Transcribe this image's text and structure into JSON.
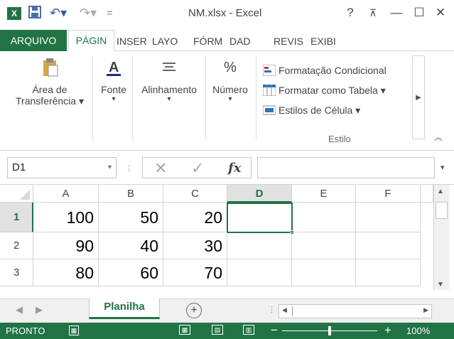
{
  "window": {
    "title": "NM.xlsx - Excel",
    "logo": "X",
    "help": "?",
    "controls": [
      "⊼",
      "—",
      "☐",
      "✕"
    ]
  },
  "quick_access": {
    "save_icon": "save-icon",
    "undo": "↶▾",
    "redo": "↷▾",
    "customize": "="
  },
  "tabs": {
    "file": "ARQUIVO",
    "active": "PÁGIN",
    "others": [
      "INSER",
      "LAYO",
      "FÓRM",
      "DAD",
      "REVIS",
      "EXIBI"
    ]
  },
  "ribbon": {
    "clipboard": {
      "line1": "Área de",
      "line2": "Transferência ▾"
    },
    "font": {
      "label": "Fonte",
      "dd": "▾"
    },
    "alignment": {
      "label": "Alinhamento",
      "dd": "▾"
    },
    "number": {
      "label": "Número",
      "dd": "▾",
      "symbol": "%"
    },
    "styles": {
      "conditional": "Formatação Condicional",
      "table": "Formatar como Tabela ▾",
      "cell": "Estilos de Célula ▾",
      "group_label": "Estilo"
    }
  },
  "formula_bar": {
    "name_box": "D1",
    "fx": "fx",
    "value": ""
  },
  "grid": {
    "columns": [
      "A",
      "B",
      "C",
      "D",
      "E",
      "F"
    ],
    "selected_column": "D",
    "rows": [
      {
        "num": "1",
        "cells": [
          "100",
          "50",
          "20",
          "",
          "",
          ""
        ]
      },
      {
        "num": "2",
        "cells": [
          "90",
          "40",
          "30",
          "",
          "",
          ""
        ]
      },
      {
        "num": "3",
        "cells": [
          "80",
          "60",
          "70",
          "",
          "",
          ""
        ]
      }
    ],
    "active_cell": "D1"
  },
  "sheets": {
    "active": "Planilha",
    "add": "+"
  },
  "status": {
    "mode": "PRONTO",
    "zoom": "100%"
  },
  "colors": {
    "accent": "#217346"
  }
}
